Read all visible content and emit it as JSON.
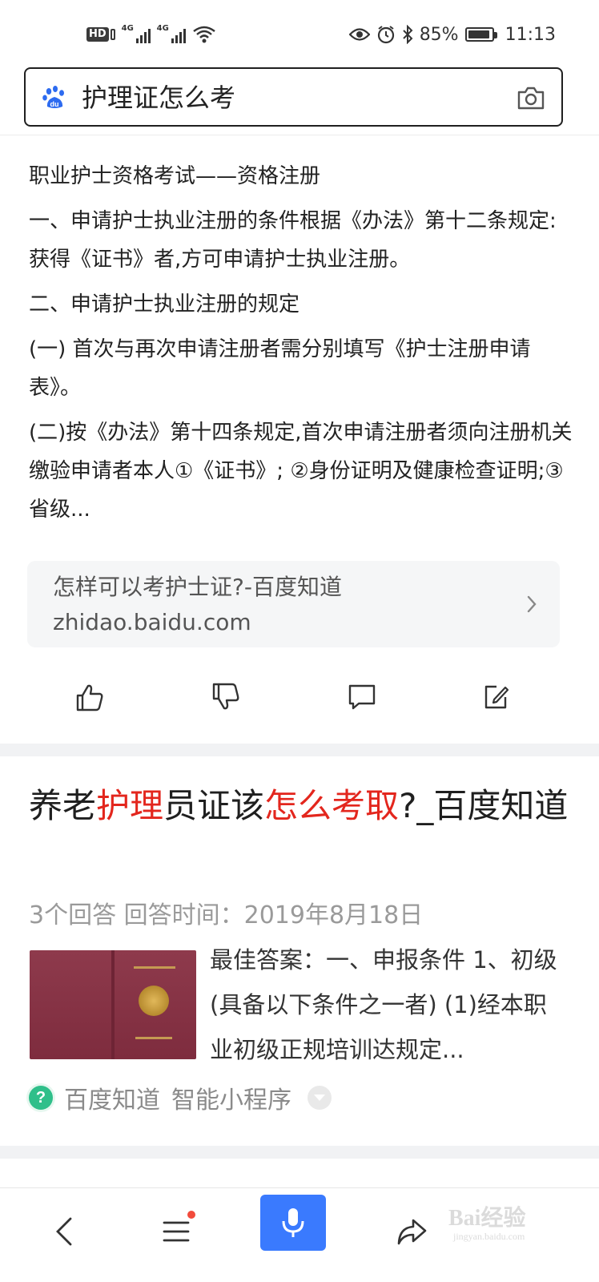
{
  "status_bar": {
    "hd": "HD",
    "sim1_tag": "4G",
    "sim2_tag": "4G",
    "battery": "85%",
    "time": "11:13"
  },
  "search": {
    "query": "护理证怎么考"
  },
  "article": {
    "paragraphs": [
      "职业护士资格考试——资格注册",
      "一、申请护士执业注册的条件根据《办法》第十二条规定:获得《证书》者,方可申请护士执业注册。",
      "二、申请护士执业注册的规定",
      "(一) 首次与再次申请注册者需分别填写《护士注册申请表》。",
      "(二)按《办法》第十四条规定,首次申请注册者须向注册机关缴验申请者本人①《证书》; ②身份证明及健康检查证明;③省级..."
    ]
  },
  "source_card": {
    "title": "怎样可以考护士证?-百度知道",
    "url": "zhidao.baidu.com"
  },
  "actions": [
    "like-icon",
    "dislike-icon",
    "comment-icon",
    "edit-icon"
  ],
  "result": {
    "title_parts": [
      "养老",
      "护理",
      "员证该",
      "怎么考取",
      "?_百度知道"
    ],
    "meta": "3个回答  回答时间：2019年8月18日",
    "snippet": "最佳答案：一、申报条件 1、初级(具备以下条件之一者) (1)经本职业初级正规培训达规定...",
    "source": "百度知道",
    "source_extra": "智能小程序"
  },
  "bottom_nav": {
    "items": [
      "back-icon",
      "menu-icon",
      "mic-icon",
      "share-icon"
    ]
  },
  "watermark": {
    "text": "Bai经验",
    "sub": "jingyan.baidu.com"
  },
  "colors": {
    "highlight": "#e3261d",
    "mic_bg": "#3a7afe",
    "source_icon": "#2fbf8a"
  }
}
